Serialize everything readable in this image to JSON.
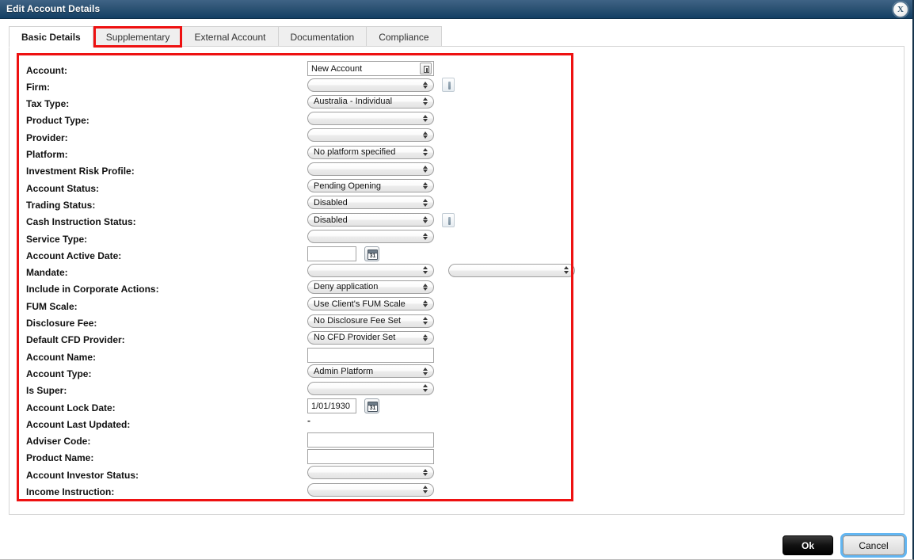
{
  "window": {
    "title": "Edit Account Details",
    "close_icon": "close-icon",
    "close_glyph": "X"
  },
  "tabs": [
    {
      "label": "Basic Details",
      "active": true,
      "flagged": false
    },
    {
      "label": "Supplementary",
      "active": false,
      "flagged": true
    },
    {
      "label": "External Account",
      "active": false,
      "flagged": false
    },
    {
      "label": "Documentation",
      "active": false,
      "flagged": false
    },
    {
      "label": "Compliance",
      "active": false,
      "flagged": false
    }
  ],
  "accent": {
    "highlight_red": "#ee1111",
    "focus_blue": "#62b6f2",
    "titlebar_top": "#3f6385",
    "titlebar_bottom": "#123f64"
  },
  "form": {
    "fields": [
      {
        "label": "Account:",
        "type": "text-lookup",
        "value": "New Account",
        "placeholder": ""
      },
      {
        "label": "Firm:",
        "type": "select",
        "value": "",
        "info": true
      },
      {
        "label": "Tax Type:",
        "type": "select",
        "value": "Australia - Individual"
      },
      {
        "label": "Product Type:",
        "type": "select",
        "value": ""
      },
      {
        "label": "Provider:",
        "type": "select",
        "value": ""
      },
      {
        "label": "Platform:",
        "type": "select",
        "value": "No platform specified"
      },
      {
        "label": "Investment Risk Profile:",
        "type": "select",
        "value": ""
      },
      {
        "label": "Account Status:",
        "type": "select",
        "value": "Pending Opening"
      },
      {
        "label": "Trading Status:",
        "type": "select",
        "value": "Disabled"
      },
      {
        "label": "Cash Instruction Status:",
        "type": "select",
        "value": "Disabled",
        "info": true
      },
      {
        "label": "Service Type:",
        "type": "select",
        "value": ""
      },
      {
        "label": "Account Active Date:",
        "type": "date",
        "value": "",
        "calendar": true
      },
      {
        "label": "Mandate:",
        "type": "select-pair",
        "value": "",
        "value2": ""
      },
      {
        "label": "Include in Corporate Actions:",
        "type": "select",
        "value": "Deny application"
      },
      {
        "label": "FUM Scale:",
        "type": "select",
        "value": "Use Client's FUM Scale"
      },
      {
        "label": "Disclosure Fee:",
        "type": "select",
        "value": "No Disclosure Fee Set"
      },
      {
        "label": "Default CFD Provider:",
        "type": "select",
        "value": "No CFD Provider Set"
      },
      {
        "label": "Account Name:",
        "type": "text",
        "value": "",
        "placeholder": ""
      },
      {
        "label": "Account Type:",
        "type": "select",
        "value": "Admin Platform"
      },
      {
        "label": "Is Super:",
        "type": "select",
        "value": ""
      },
      {
        "label": "Account Lock Date:",
        "type": "date",
        "value": "1/01/1930",
        "calendar": true
      },
      {
        "label": "Account Last Updated:",
        "type": "static",
        "value": "-"
      },
      {
        "label": "Adviser Code:",
        "type": "text",
        "value": "",
        "placeholder": ""
      },
      {
        "label": "Product Name:",
        "type": "text",
        "value": "",
        "placeholder": ""
      },
      {
        "label": "Account Investor Status:",
        "type": "select",
        "value": ""
      },
      {
        "label": "Income Instruction:",
        "type": "select",
        "value": ""
      }
    ],
    "calendar_day": "31"
  },
  "footer": {
    "ok_label": "Ok",
    "cancel_label": "Cancel"
  }
}
